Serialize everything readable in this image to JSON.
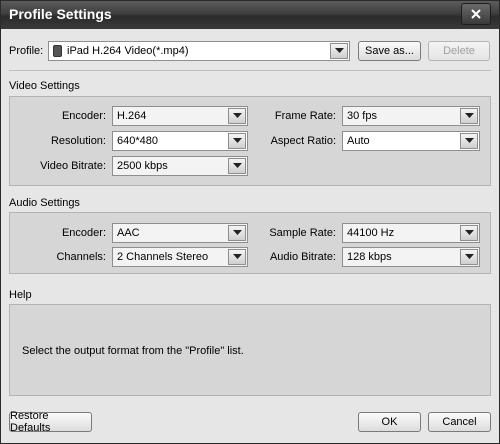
{
  "window": {
    "title": "Profile Settings"
  },
  "profile": {
    "label": "Profile:",
    "value": "iPad H.264 Video(*.mp4)",
    "save_as_label": "Save as...",
    "delete_label": "Delete"
  },
  "video": {
    "section_title": "Video Settings",
    "encoder": {
      "label": "Encoder:",
      "value": "H.264"
    },
    "resolution": {
      "label": "Resolution:",
      "value": "640*480"
    },
    "bitrate": {
      "label": "Video Bitrate:",
      "value": "2500 kbps"
    },
    "frame_rate": {
      "label": "Frame Rate:",
      "value": "30 fps"
    },
    "aspect_ratio": {
      "label": "Aspect Ratio:",
      "value": "Auto"
    }
  },
  "audio": {
    "section_title": "Audio Settings",
    "encoder": {
      "label": "Encoder:",
      "value": "AAC"
    },
    "channels": {
      "label": "Channels:",
      "value": "2 Channels Stereo"
    },
    "sample_rate": {
      "label": "Sample Rate:",
      "value": "44100 Hz"
    },
    "bitrate": {
      "label": "Audio Bitrate:",
      "value": "128 kbps"
    }
  },
  "help": {
    "section_title": "Help",
    "text": "Select the output format from the \"Profile\" list."
  },
  "footer": {
    "restore_label": "Restore Defaults",
    "ok_label": "OK",
    "cancel_label": "Cancel"
  },
  "icons": {
    "close": "close-icon",
    "dropdown": "chevron-down-icon",
    "profile": "ipad-icon"
  }
}
